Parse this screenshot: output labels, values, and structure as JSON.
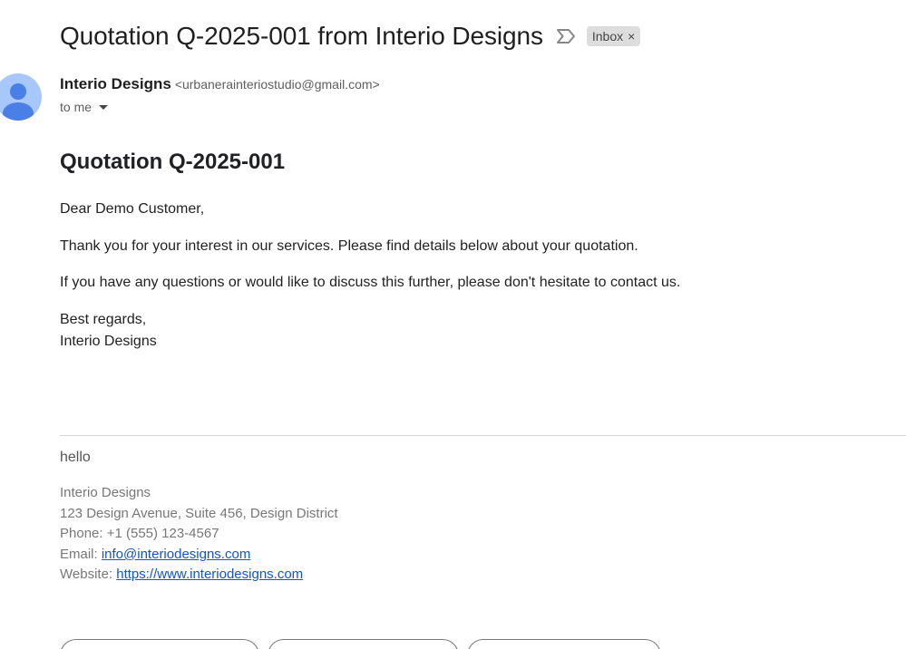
{
  "header": {
    "subject": "Quotation Q-2025-001 from Interio Designs",
    "label_chip": "Inbox",
    "label_chip_close": "×"
  },
  "sender": {
    "name": "Interio Designs",
    "email": "<urbanerainteriostudio@gmail.com>",
    "recipient_line": "to me"
  },
  "message": {
    "heading": "Quotation Q-2025-001",
    "greeting": "Dear Demo Customer,",
    "paragraph_1": "Thank you for your interest in our services. Please find details below about your quotation.",
    "paragraph_2": "If you have any questions or would like to discuss this further, please don't hesitate to contact us.",
    "closing": "Best regards,",
    "closing_name": "Interio Designs"
  },
  "footer": {
    "note": "hello",
    "signature": {
      "company": "Interio Designs",
      "address": "123 Design Avenue, Suite 456, Design District",
      "phone": "Phone: +1 (555) 123-4567",
      "email_label": "Email: ",
      "email": "info@interiodesigns.com",
      "website_label": "Website: ",
      "website": "https://www.interiodesigns.com"
    }
  },
  "colors": {
    "avatar_bg": "#a8c7fa",
    "avatar_fg": "#4a7fe8",
    "link": "#1155cc",
    "chip_bg": "#dddddd"
  },
  "icons": {
    "important_marker": "importance-marker-icon",
    "avatar": "person-avatar-icon",
    "details_toggle": "caret-down-icon"
  }
}
